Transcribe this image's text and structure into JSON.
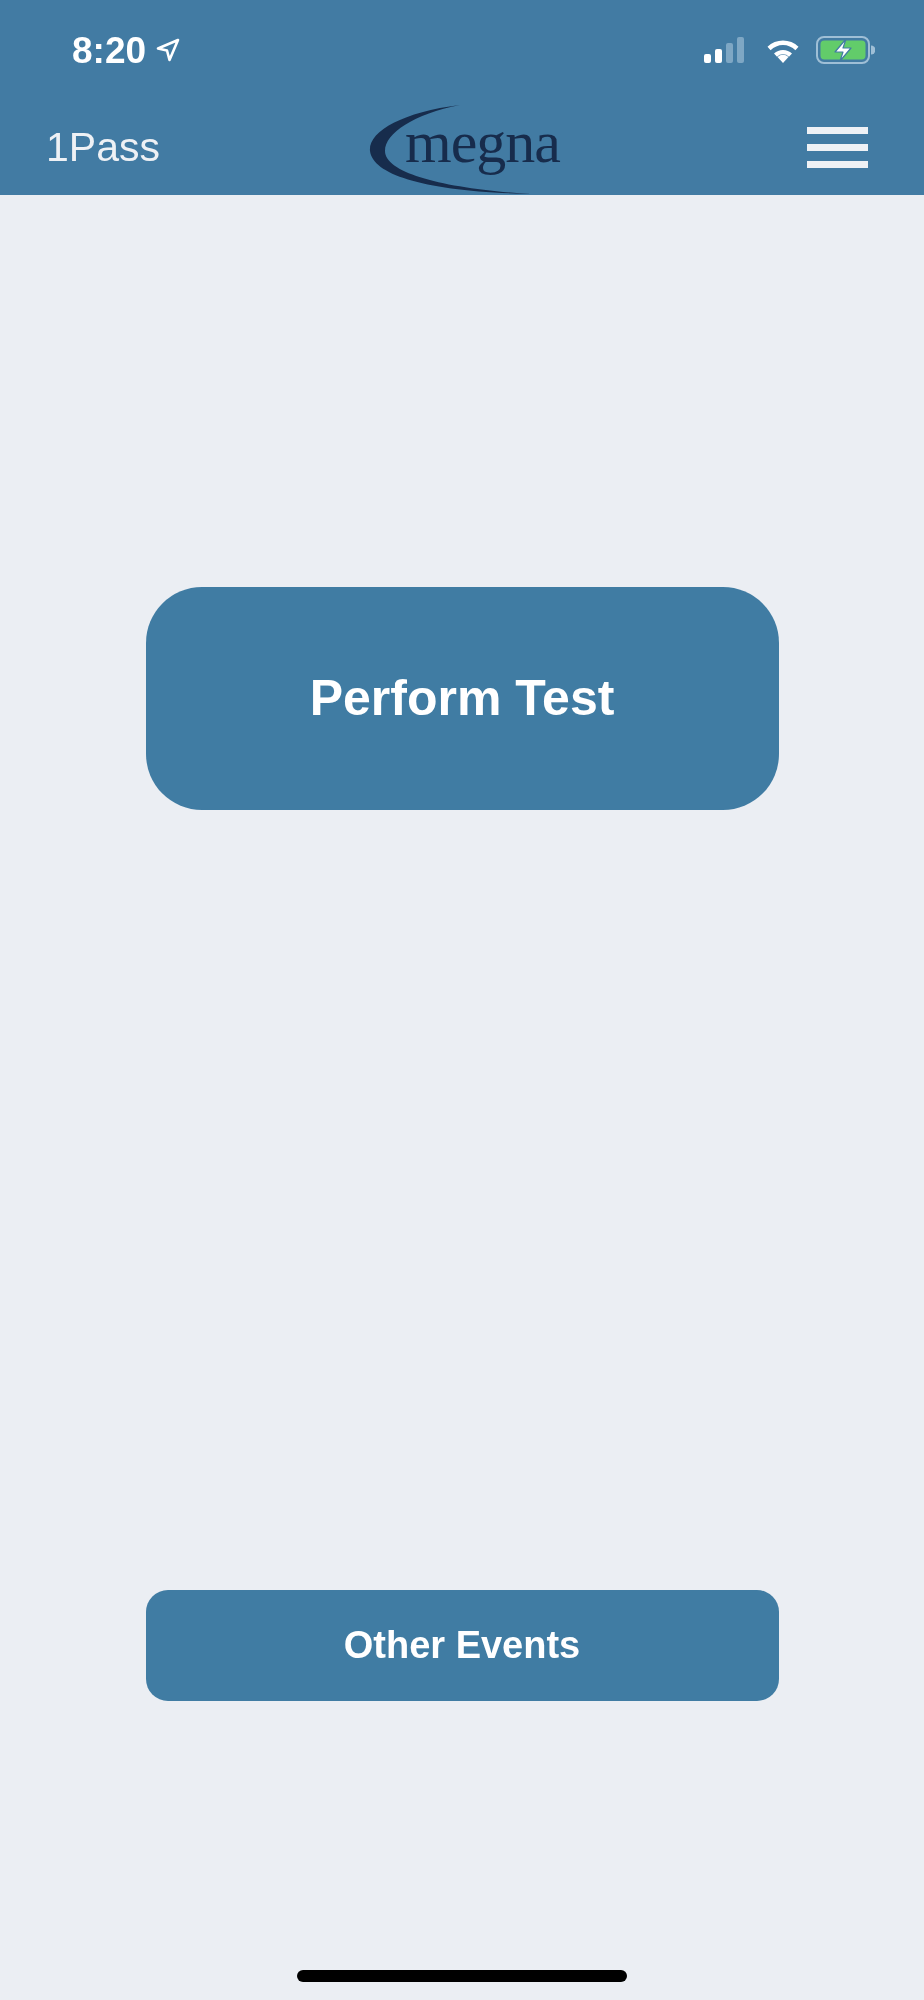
{
  "status_bar": {
    "time": "8:20"
  },
  "nav_bar": {
    "title": "1Pass",
    "logo_text": "megna"
  },
  "buttons": [
    {
      "label": "Perform Test",
      "kind": "large"
    },
    {
      "label": "Other Events",
      "kind": "small"
    }
  ]
}
